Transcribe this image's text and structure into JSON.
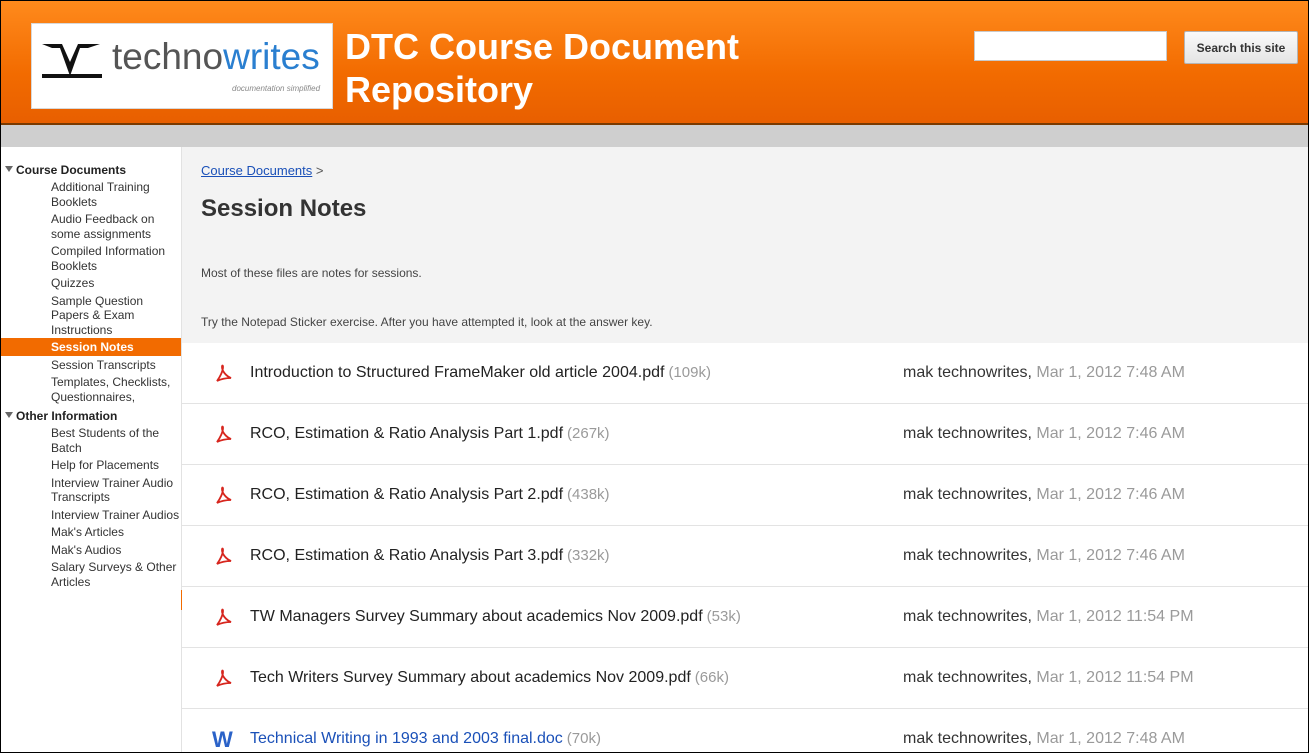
{
  "header": {
    "logo": {
      "word_left": "techno",
      "word_right": "writes",
      "tagline": "documentation simplified"
    },
    "site_title": "DTC Course Document Repository",
    "search": {
      "value": "",
      "button": "Search this site"
    },
    "colors": {
      "brand_orange": "#f26b00",
      "link_blue": "#1a50b8"
    }
  },
  "sidebar": {
    "sections": [
      {
        "title": "Course Documents",
        "items": [
          {
            "label": "Additional Training Booklets",
            "active": false
          },
          {
            "label": "Audio Feedback on some assignments",
            "active": false
          },
          {
            "label": "Compiled Information Booklets",
            "active": false
          },
          {
            "label": "Quizzes",
            "active": false
          },
          {
            "label": "Sample Question Papers & Exam Instructions",
            "active": false
          },
          {
            "label": "Session Notes",
            "active": true
          },
          {
            "label": "Session Transcripts",
            "active": false
          },
          {
            "label": "Templates, Checklists, Questionnaires,",
            "active": false
          }
        ]
      },
      {
        "title": "Other Information",
        "items": [
          {
            "label": "Best Students of the Batch",
            "active": false
          },
          {
            "label": "Help for Placements",
            "active": false
          },
          {
            "label": "Interview Trainer Audio Transcripts",
            "active": false
          },
          {
            "label": "Interview Trainer Audios",
            "active": false
          },
          {
            "label": "Mak's Articles",
            "active": false
          },
          {
            "label": "Mak's Audios",
            "active": false
          },
          {
            "label": "Salary Surveys & Other Articles",
            "active": false
          }
        ]
      }
    ]
  },
  "main": {
    "breadcrumb": {
      "link": "Course Documents",
      "separator": " >"
    },
    "title": "Session Notes",
    "description": [
      "Most of these files are notes for sessions.",
      "Try the Notepad Sticker exercise. After you have attempted it, look at the answer key."
    ],
    "files": [
      {
        "icon": "pdf-icon",
        "name": "Introduction to Structured FrameMaker old article 2004.pdf",
        "size": "(109k)",
        "author": "mak technowrites,",
        "date": "Mar 1, 2012 7:48 AM"
      },
      {
        "icon": "pdf-icon",
        "name": "RCO, Estimation & Ratio Analysis Part 1.pdf",
        "size": "(267k)",
        "author": "mak technowrites,",
        "date": "Mar 1, 2012 7:46 AM"
      },
      {
        "icon": "pdf-icon",
        "name": "RCO, Estimation & Ratio Analysis Part 2.pdf",
        "size": "(438k)",
        "author": "mak technowrites,",
        "date": "Mar 1, 2012 7:46 AM"
      },
      {
        "icon": "pdf-icon",
        "name": "RCO, Estimation & Ratio Analysis Part 3.pdf",
        "size": "(332k)",
        "author": "mak technowrites,",
        "date": "Mar 1, 2012 7:46 AM"
      },
      {
        "icon": "pdf-icon",
        "name": "TW Managers Survey Summary about academics Nov 2009.pdf",
        "size": "(53k)",
        "author": "mak technowrites,",
        "date": "Mar 1, 2012 11:54 PM"
      },
      {
        "icon": "pdf-icon",
        "name": "Tech Writers Survey Summary about academics Nov 2009.pdf",
        "size": "(66k)",
        "author": "mak technowrites,",
        "date": "Mar 1, 2012 11:54 PM"
      },
      {
        "icon": "word-icon",
        "name": "Technical Writing in 1993 and 2003 final.doc",
        "size": "(70k)",
        "author": "mak technowrites,",
        "date": "Mar 1, 2012 7:48 AM"
      }
    ]
  }
}
